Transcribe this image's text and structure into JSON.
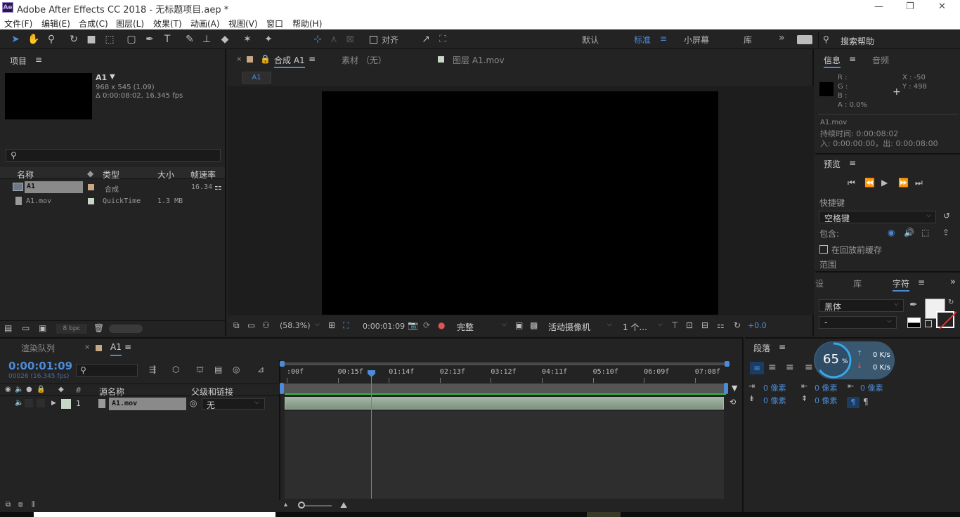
{
  "window": {
    "title": "Adobe After Effects CC 2018 - 无标题项目.aep *",
    "logo": "Ae",
    "controls": [
      "—",
      "❐",
      "✕"
    ]
  },
  "menu": [
    "文件(F)",
    "编辑(E)",
    "合成(C)",
    "图层(L)",
    "效果(T)",
    "动画(A)",
    "视图(V)",
    "窗口",
    "帮助(H)"
  ],
  "toolbar": {
    "align_label": "对齐",
    "workspaces": [
      "默认",
      "标准",
      "小屏幕",
      "库"
    ],
    "active_workspace": "标准",
    "overflow": "»",
    "search_placeholder": "搜索帮助"
  },
  "project": {
    "title": "项目",
    "item_name": "A1",
    "item_dims": "968 x 545 (1.09)",
    "item_duration": "Δ 0:00:08:02, 16.345 fps",
    "search_placeholder": "",
    "columns": [
      "名称",
      "类型",
      "大小",
      "帧速率"
    ],
    "rows": [
      {
        "name": "A1",
        "type": "合成",
        "size": "",
        "fps": "16.34"
      },
      {
        "name": "A1.mov",
        "type": "QuickTime",
        "size": "1.3 MB",
        "fps": ""
      }
    ],
    "bpc": "8 bpc"
  },
  "viewer": {
    "tabs": [
      "合成 A1",
      "素材 （无）",
      "图层 A1.mov"
    ],
    "breadcrumb": "A1",
    "zoom": "(58.3%)",
    "timecode": "0:00:01:09",
    "resolution": "完整",
    "camera": "活动摄像机",
    "views": "1 个...",
    "exposure": "+0.0"
  },
  "info": {
    "tab_info": "信息",
    "tab_audio": "音频",
    "r": "R :",
    "g": "G :",
    "b": "B :",
    "a": "A :  0.0%",
    "x": "X : -50",
    "y": "Y : 498",
    "file": "A1.mov",
    "duration": "持续时间: 0:00:08:02",
    "inout": "入: 0:00:00:00，出: 0:00:08:00"
  },
  "preview": {
    "title": "预览",
    "shortcut_label": "快捷键",
    "shortcut_value": "空格键",
    "include_label": "包含:",
    "cache_label": "在回放前缓存",
    "range_label": "范围"
  },
  "character": {
    "tabs": [
      "设",
      "库",
      "字符"
    ],
    "font": "黑体",
    "style": "-"
  },
  "paragraph": {
    "title": "段落",
    "indent_labels": [
      "0 像素",
      "0 像素",
      "0 像素",
      "0 像素",
      "0 像素"
    ],
    "speed_up": "0 K/s",
    "speed_down": "0 K/s",
    "cpu_percent": 65,
    "cpu_label": "65"
  },
  "timeline": {
    "tab_render": "渲染队列",
    "tab_comp": "A1",
    "timecode": "0:00:01:09",
    "frame_info": "00026 (16.345 fps)",
    "col_source": "源名称",
    "col_parent": "父级和链接",
    "col_num": "#",
    "ruler": [
      ":00f",
      "00:15f",
      "01:14f",
      "02:13f",
      "03:12f",
      "04:11f",
      "05:10f",
      "06:09f",
      "07:08f"
    ],
    "layer_num": "1",
    "layer_name": "A1.mov",
    "parent_value": "无",
    "playhead_fraction": 0.205
  },
  "colors": {
    "accent": "#4b8bd8",
    "panel": "#232323",
    "dark": "#1a1a1a"
  }
}
